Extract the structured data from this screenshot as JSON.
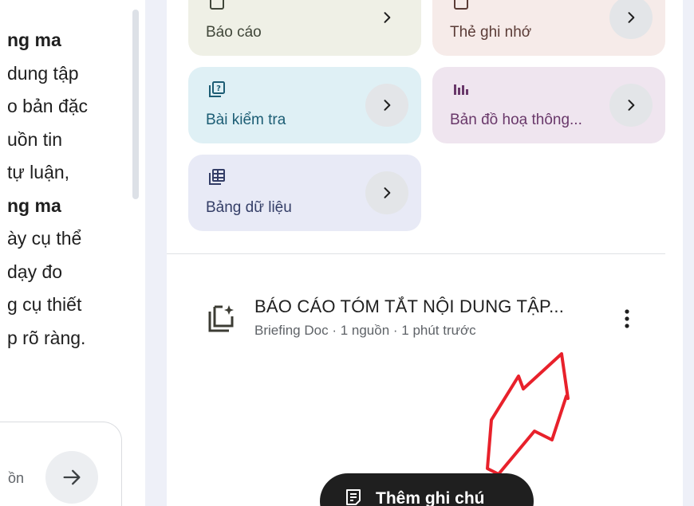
{
  "chat": {
    "lines": [
      {
        "text": "ng ma",
        "bold": true
      },
      {
        "text": "dung tập",
        "bold": false
      },
      {
        "text": "o bản đặc",
        "bold": false
      },
      {
        "text": "uồn tin",
        "bold": false
      },
      {
        "text": "tự luận,",
        "bold": false
      },
      {
        "text": "ng ma",
        "bold": true
      },
      {
        "text": "ày cụ thể",
        "bold": false
      },
      {
        "text": "dạy đo",
        "bold": false
      },
      {
        "text": "g cụ thiết",
        "bold": false
      },
      {
        "text": "p rõ ràng.",
        "bold": false
      }
    ],
    "input_text": "ồn"
  },
  "studio": {
    "tiles": {
      "report": "Báo cáo",
      "flashcards": "Thẻ ghi nhớ",
      "quiz": "Bài kiểm tra",
      "infographic": "Bản đồ hoạ thông...",
      "data_table": "Bảng dữ liệu"
    },
    "note": {
      "title": "BÁO CÁO TÓM TẮT NỘI DUNG TẬP...",
      "meta": "Briefing Doc · 1 nguồn · 1 phút trước"
    },
    "add_note_label": "Thêm ghi chú"
  },
  "colors": {
    "annotation_arrow": "#e8212b",
    "report_tile": "#eff0e6",
    "flashcards_tile": "#f6ebe9",
    "quiz_tile": "#dff0f5",
    "infographic_tile": "#efe5ef",
    "table_tile": "#e8eaf6"
  }
}
